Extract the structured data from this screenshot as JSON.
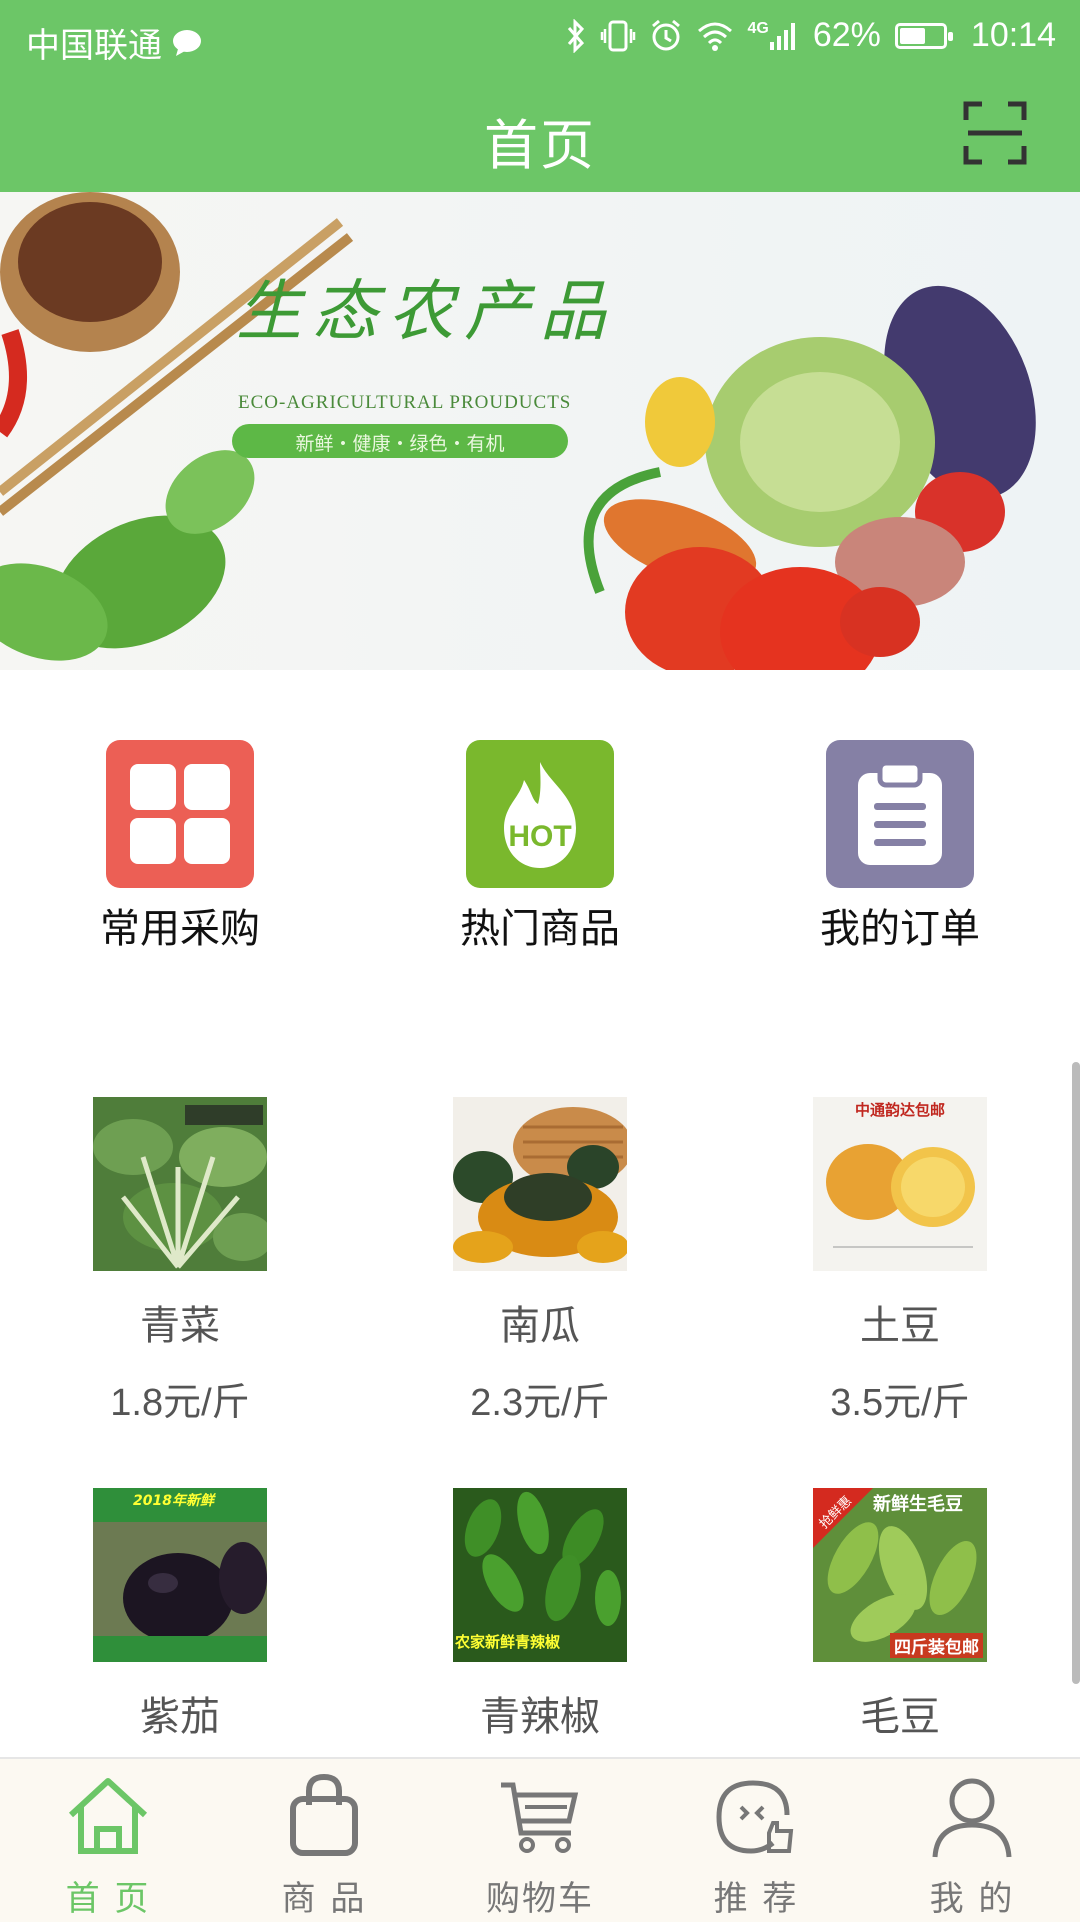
{
  "status_bar": {
    "carrier": "中国联通",
    "network": "4G",
    "battery": "62%",
    "battery_fraction": 0.62,
    "time": "10:14",
    "icons": [
      "message-icon",
      "bluetooth-icon",
      "vibrate-icon",
      "alarm-icon",
      "wifi-icon",
      "signal-icon",
      "battery-icon"
    ]
  },
  "header": {
    "title": "首页",
    "scan_icon": "scan-icon"
  },
  "banner": {
    "title": "生态农产品",
    "subtitle": "ECO-AGRICULTURAL PROUDUCTS",
    "tagline": "新鲜・健康・绿色・有机"
  },
  "quick_entries": [
    {
      "label": "常用采购",
      "icon": "grid-icon",
      "color": "#ec5f55"
    },
    {
      "label": "热门商品",
      "icon": "hot-flame-icon",
      "color": "#7ab82d",
      "icon_text": "HOT"
    },
    {
      "label": "我的订单",
      "icon": "clipboard-icon",
      "color": "#8580a5"
    }
  ],
  "products": [
    {
      "name": "青菜",
      "price": "1.8元/斤"
    },
    {
      "name": "南瓜",
      "price": "2.3元/斤"
    },
    {
      "name": "土豆",
      "price": "3.5元/斤",
      "img_text": "中通韵达包邮"
    },
    {
      "name": "紫茄",
      "img_text": "2018年新鲜"
    },
    {
      "name": "青辣椒",
      "img_text": "农家新鲜青辣椒"
    },
    {
      "name": "毛豆",
      "img_text": "新鲜生毛豆",
      "img_text2": "四斤装包邮",
      "img_badge": "抢鲜惠"
    }
  ],
  "bottom_nav": [
    {
      "label": "首 页",
      "icon": "home-icon",
      "active": true
    },
    {
      "label": "商 品",
      "icon": "shopping-bag-icon",
      "active": false
    },
    {
      "label": "购物车",
      "icon": "cart-icon",
      "active": false
    },
    {
      "label": "推 荐",
      "icon": "recommend-icon",
      "active": false
    },
    {
      "label": "我 的",
      "icon": "profile-icon",
      "active": false
    }
  ],
  "colors": {
    "primary_green": "#6cc667",
    "nav_active": "#6cc667",
    "nav_inactive": "#777777"
  }
}
